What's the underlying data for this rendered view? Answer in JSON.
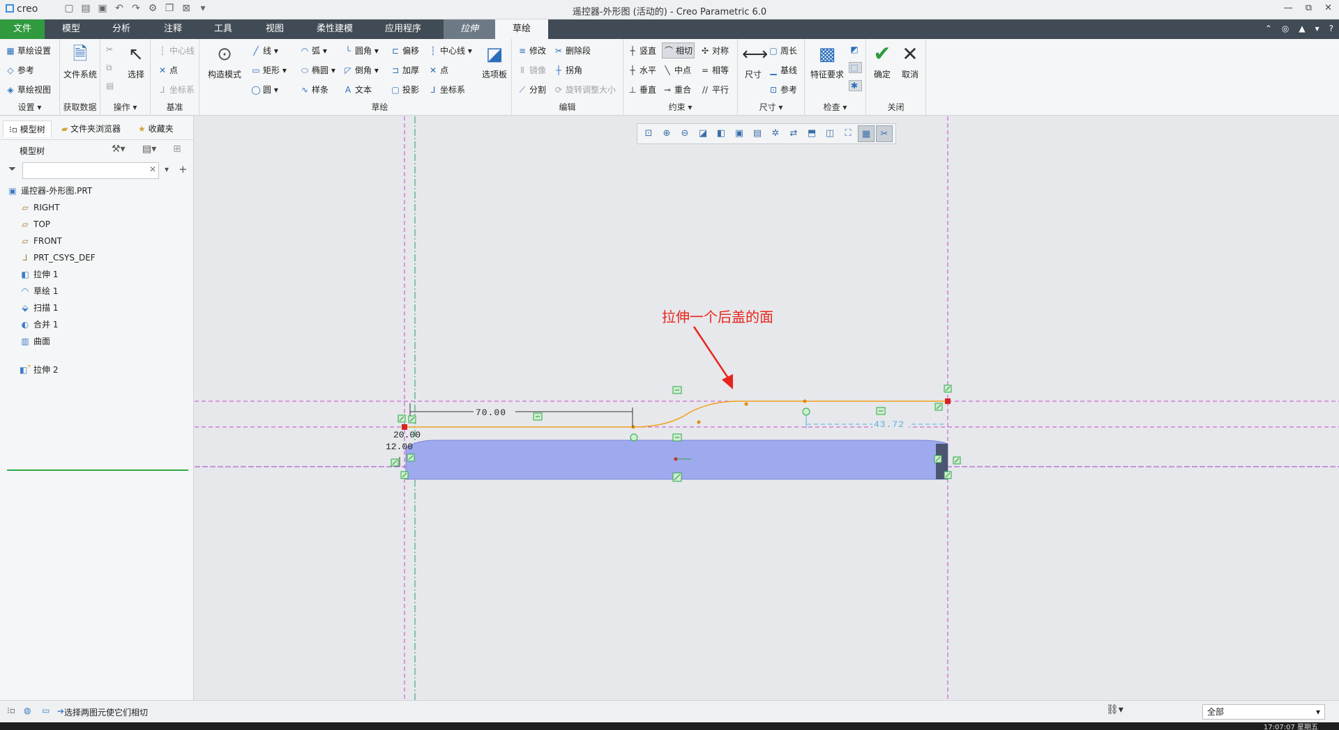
{
  "app": {
    "logo": "creo",
    "window_title": "遥控器-外形图 (活动的) - Creo Parametric 6.0",
    "quick_access": [
      "new-icon",
      "open-icon",
      "save-icon",
      "undo-icon",
      "redo-icon",
      "regenerate-icon",
      "windows-icon",
      "close-window-icon",
      "customize-icon"
    ],
    "window_buttons": [
      "—",
      "⧉",
      "✕"
    ]
  },
  "tabs": [
    {
      "label": "文件",
      "kind": "file"
    },
    {
      "label": "模型",
      "kind": "normal"
    },
    {
      "label": "分析",
      "kind": "normal"
    },
    {
      "label": "注释",
      "kind": "normal"
    },
    {
      "label": "工具",
      "kind": "normal"
    },
    {
      "label": "视图",
      "kind": "normal"
    },
    {
      "label": "柔性建模",
      "kind": "normal"
    },
    {
      "label": "应用程序",
      "kind": "normal"
    },
    {
      "label": "拉伸",
      "kind": "ext"
    },
    {
      "label": "草绘",
      "kind": "active"
    }
  ],
  "ribbon": {
    "setup": {
      "label": "设置 ▾",
      "items": [
        "草绘设置",
        "参考",
        "草绘视图"
      ]
    },
    "get_data": {
      "label": "获取数据",
      "big": "文件系统"
    },
    "operations": {
      "label": "操作 ▾",
      "select": "选择"
    },
    "datum": {
      "label": "基准",
      "items": [
        "中心线",
        "点",
        "坐标系"
      ]
    },
    "construct": {
      "big": "构造模式"
    },
    "sketch": {
      "label": "草绘",
      "col1": [
        "线 ▾",
        "矩形 ▾",
        "圆 ▾"
      ],
      "col2": [
        "弧 ▾",
        "椭圆 ▾",
        "样条"
      ],
      "col3": [
        "圆角 ▾",
        "倒角 ▾",
        "文本"
      ],
      "col4": [
        "偏移",
        "加厚",
        "投影"
      ],
      "col5": [
        "中心线 ▾",
        "点",
        "坐标系"
      ],
      "palette": "选项板"
    },
    "edit": {
      "label": "编辑",
      "col1": [
        "修改",
        "镜像",
        "分割"
      ],
      "col2": [
        "删除段",
        "拐角",
        "旋转调整大小"
      ]
    },
    "constrain": {
      "label": "约束 ▾",
      "col1": [
        "竖直",
        "水平",
        "垂直"
      ],
      "col2": [
        "相切",
        "中点",
        "重合"
      ],
      "col3": [
        "对称",
        "相等",
        "平行"
      ]
    },
    "dimension": {
      "label": "尺寸 ▾",
      "big": "尺寸",
      "items": [
        "周长",
        "基线",
        "参考"
      ]
    },
    "inspect": {
      "label": "检查 ▾",
      "big": "特征要求"
    },
    "close": {
      "label": "关闭",
      "ok": "确定",
      "cancel": "取消"
    }
  },
  "left_panel": {
    "tabs": [
      "模型树",
      "文件夹浏览器",
      "收藏夹"
    ],
    "header": "模型树",
    "filter_placeholder": "",
    "tree": [
      {
        "label": "遥控器-外形图.PRT",
        "icon": "part-icon",
        "indent": 0
      },
      {
        "label": "RIGHT",
        "icon": "datum-plane-icon",
        "indent": 1
      },
      {
        "label": "TOP",
        "icon": "datum-plane-icon",
        "indent": 1
      },
      {
        "label": "FRONT",
        "icon": "datum-plane-icon",
        "indent": 1
      },
      {
        "label": "PRT_CSYS_DEF",
        "icon": "csys-icon",
        "indent": 1
      },
      {
        "label": "拉伸 1",
        "icon": "extrude-icon",
        "indent": 1
      },
      {
        "label": "草绘 1",
        "icon": "sketch-icon",
        "indent": 1
      },
      {
        "label": "扫描 1",
        "icon": "sweep-icon",
        "indent": 1
      },
      {
        "label": "合并 1",
        "icon": "merge-icon",
        "indent": 1
      },
      {
        "label": "曲面",
        "icon": "surface-icon",
        "indent": 1
      }
    ],
    "new_feature": "拉伸 2"
  },
  "canvas": {
    "annotation": "拉伸一个后盖的面",
    "dims": {
      "d70": "70.00",
      "d20": "20.00",
      "d12": "12.00",
      "d43": "43.72"
    },
    "colors": {
      "sketch": "#f2a01c",
      "ref": "#cc44cc",
      "solid": "#9ea9ee",
      "dim": "#5bb0e0",
      "arrow": "#e8251c"
    }
  },
  "status": {
    "message": "选择两图元使它们相切",
    "filter": "全部",
    "clock": "17:07:07 星期五"
  }
}
